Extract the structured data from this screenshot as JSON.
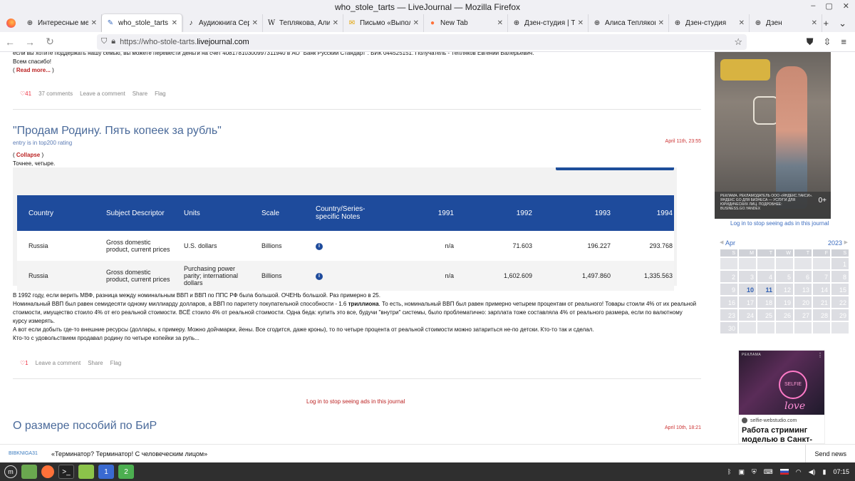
{
  "window": {
    "title": "who_stole_tarts — LiveJournal — Mozilla Firefox"
  },
  "tabs": [
    {
      "label": "Интересные места",
      "favicon": "plus-circle-icon"
    },
    {
      "label": "who_stole_tarts — L",
      "favicon": "lj-icon",
      "active": true
    },
    {
      "label": "Аудиокнига Сергей",
      "favicon": "audio-icon"
    },
    {
      "label": "Теплякова, Алиса Е",
      "favicon": "wiki-icon"
    },
    {
      "label": "Письмо «Выполнен",
      "favicon": "mail-icon"
    },
    {
      "label": "New Tab",
      "favicon": "firefox-icon"
    },
    {
      "label": "Дзен-студия | Тепл",
      "favicon": "plus-circle-icon"
    },
    {
      "label": "Алиса Теплякова н",
      "favicon": "plus-circle-icon"
    },
    {
      "label": "Дзен-студия",
      "favicon": "plus-circle-icon"
    },
    {
      "label": "Дзен",
      "favicon": "plus-circle-icon"
    }
  ],
  "navbar": {
    "url_prefix": "https://who-stole-tarts.",
    "url_host": "livejournal.com"
  },
  "post1": {
    "donation": "если вы хотите поддержать нашу семью, вы можете перевести деньги на счет 40817810300997311940 в АО \"Банк Русский Стандарт\". БИК 044525151. Получатель - Тепляков Евгений Валерьевич.",
    "thanks": "Всем спасибо!",
    "read_more": "Read more...",
    "likes": "41",
    "comments": "37 comments",
    "leave": "Leave a comment",
    "share": "Share",
    "flag": "Flag"
  },
  "post2": {
    "title": "\"Продам Родину. Пять копеек за рубль\"",
    "subtitle": "entry is in top200 rating",
    "date": "April 11th, 23:55",
    "collapse": "Collapse",
    "intro": "Точнее, четыре.",
    "table": {
      "headers": [
        "Country",
        "Subject Descriptor",
        "Units",
        "Scale",
        "Country/Series-specific Notes",
        "1991",
        "1992",
        "1993",
        "1994"
      ],
      "rows": [
        [
          "Russia",
          "Gross domestic product, current prices",
          "U.S. dollars",
          "Billions",
          "i",
          "n/a",
          "71.603",
          "196.227",
          "293.768"
        ],
        [
          "Russia",
          "Gross domestic product, current prices",
          "Purchasing power parity; international dollars",
          "Billions",
          "i",
          "n/a",
          "1,602.609",
          "1,497.860",
          "1,335.563"
        ]
      ]
    },
    "p1": "В 1992 году, если верить МВФ, разница между номинальным ВВП и ВВП по ППС РФ была большой. ОЧЕНЬ большой. Раз примерно в 25.",
    "p2a": "Номинальный ВВП был равен семидесяти одному миллиарду долларов, а ВВП по паритету покупательной способности - 1.6 ",
    "p2b": "триллиона",
    "p2c": ". То есть, номинальный ВВП был равен примерно четырем процентам от реального! Товары стоили 4% от их реальной стоимости, имущество стоило 4% от его реальной стоимости. ВСЁ стоило 4% от реальной стоимости. Одна беда: купить это все, будучи \"внутри\" системы, было проблематично: зарплата тоже составляла 4% от реального размера, если по валютному курсу измерять.",
    "p3": "А вот если добыть где-то внешние ресурсы (доллары, к примеру. Можно дойчмарки, йены. Все сгодится, даже кроны), то по четыре процента от реальной стоимости можно затариться не-по детски. Кто-то так и сделал.",
    "p4": "Кто-то с удовольствием продавал родину по четыре копейки за рупь...",
    "likes": "1",
    "leave": "Leave a comment",
    "share": "Share",
    "flag": "Flag"
  },
  "center_link": "Log in to stop seeing ads in this journal",
  "post3": {
    "title": "О размере пособий по БиР",
    "date": "April 10th, 18:21"
  },
  "sidebar": {
    "ad_text": "РЕКЛАМА. РЕКЛАМОДАТЕЛЬ ООО «ЯНДЕКС.ТАКСИ». ЯНДЕКС GO ДЛЯ БИЗНЕСА — УСЛУГИ ДЛЯ ЮРИДИЧЕСКИХ ЛИЦ. ПОДРОБНЕЕ: BUSINESS.GO.YANDEX",
    "ad_rating": "0+",
    "stop_ads": "Log in to stop seeing ads in this journal",
    "calendar": {
      "month": "Apr",
      "year": "2023",
      "weekdays": [
        "S",
        "M",
        "T",
        "W",
        "T",
        "F",
        "S"
      ],
      "weeks": [
        [
          "",
          "",
          "",
          "",
          "",
          "",
          "1"
        ],
        [
          "2",
          "3",
          "4",
          "5",
          "6",
          "7",
          "8"
        ],
        [
          "9",
          "10",
          "11",
          "12",
          "13",
          "14",
          "15"
        ],
        [
          "16",
          "17",
          "18",
          "19",
          "20",
          "21",
          "22"
        ],
        [
          "23",
          "24",
          "25",
          "26",
          "27",
          "28",
          "29"
        ],
        [
          "30",
          "",
          "",
          "",
          "",
          "",
          ""
        ]
      ],
      "linked_days": [
        "10",
        "11"
      ]
    },
    "ad2": {
      "tag": "РЕКЛАМА",
      "brand": "SELFIE",
      "neon": "love",
      "site": "selfie-webstudio.com",
      "headline": "Работа стриминг моделью в Санкт-"
    }
  },
  "newsbar": {
    "source": "BIBKNIGA31",
    "headline": "«Терминатор? Терминатор! С человеческим лицом»",
    "send": "Send news"
  },
  "taskbar": {
    "time": "07:15",
    "workspaces": [
      "1",
      "2"
    ]
  }
}
